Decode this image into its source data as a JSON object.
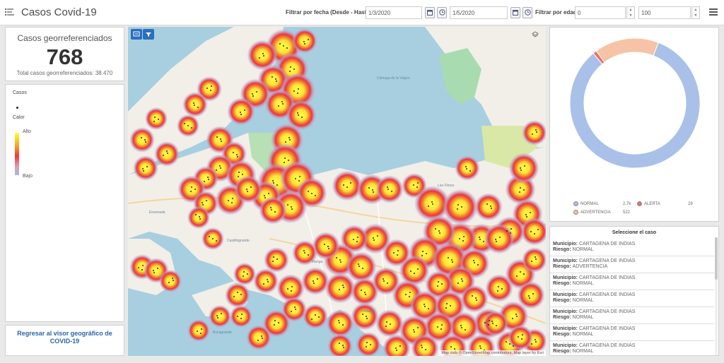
{
  "app": {
    "title": "Casos Covid-19"
  },
  "filters": {
    "date_label": "Filtrar por fecha (Desde - Hasta)",
    "date_from": "1/3/2020",
    "date_to": "1/5/2020",
    "age_label": "Filtrar por edad",
    "age_from": "0",
    "age_to": "100",
    "spin_up": "▲",
    "spin_down": "▼"
  },
  "kpi": {
    "title": "Casos georreferenciados",
    "value": "768",
    "subtitle": "Total casos georreferenciados: 38.470"
  },
  "legend": {
    "cases_label": "Casos",
    "heat_label": "Calor",
    "high_label": "Alto",
    "low_label": "Bajo"
  },
  "back_link": "Regresar al visor geográfico de COVID-19",
  "map": {
    "attribution": "Map data © OpenStreetMap contributors, Map layer by Esri",
    "labels": [
      "Ciénaga de la Virgen",
      "Las Flores",
      "Ensenada",
      "Castillogrande",
      "Manga",
      "Ceballos",
      "Bocagrande"
    ]
  },
  "donut": {
    "legend": [
      {
        "label": "NORMAL",
        "value": "2,7k",
        "color": "#a9c1e8"
      },
      {
        "label": "ALERTA",
        "value": "29",
        "color": "#ef6b6b"
      },
      {
        "label": "ADVERTENCIA",
        "value": "522",
        "color": "#f6c3a6"
      }
    ]
  },
  "cases_list": {
    "title": "Seleccione el caso",
    "municipio_label": "Municipio:",
    "riesgo_label": "Riesgo:",
    "items": [
      {
        "municipio": "CARTAGENA DE INDIAS",
        "riesgo": "NORMAL"
      },
      {
        "municipio": "CARTAGENA DE INDIAS",
        "riesgo": "ADVERTENCIA"
      },
      {
        "municipio": "CARTAGENA DE INDIAS",
        "riesgo": "NORMAL"
      },
      {
        "municipio": "CARTAGENA DE INDIAS",
        "riesgo": "NORMAL"
      },
      {
        "municipio": "CARTAGENA DE INDIAS",
        "riesgo": "NORMAL"
      },
      {
        "municipio": "CARTAGENA DE INDIAS",
        "riesgo": "NORMAL"
      },
      {
        "municipio": "CARTAGENA DE INDIAS",
        "riesgo": "NORMAL"
      }
    ]
  },
  "colors": {
    "accent": "#2b6fbf",
    "heat_high": "#ffff3c",
    "heat_mid": "#ee3b3b",
    "heat_low": "#aab7e6"
  }
}
